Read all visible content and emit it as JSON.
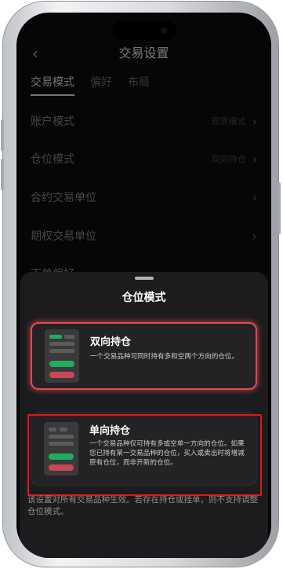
{
  "header": {
    "back_label": "‹",
    "title": "交易设置"
  },
  "tabs": [
    {
      "label": "交易模式",
      "active": true
    },
    {
      "label": "偏好",
      "active": false
    },
    {
      "label": "布局",
      "active": false
    }
  ],
  "settings": [
    {
      "label": "账户模式",
      "value": "现货模式"
    },
    {
      "label": "仓位模式",
      "value": "双向持仓"
    },
    {
      "label": "合约交易单位",
      "value": ""
    },
    {
      "label": "期权交易单位",
      "value": ""
    },
    {
      "label": "下单偏好",
      "value": ""
    }
  ],
  "sheet": {
    "title": "仓位模式",
    "options": [
      {
        "title": "双向持仓",
        "description": "一个交易品种可同时持有多和空两个方向的仓位。",
        "selected": true
      },
      {
        "title": "单向持仓",
        "description": "一个交易品种仅可持有多或空单一方向的仓位。如果您已持有某一交易品种的仓位，买入或卖出时将增减原有仓位，而非开新的仓位。",
        "selected": false
      }
    ],
    "footnote": "该设置对所有交易品种生效。若存在持仓或挂单，则不支持调整仓位模式。"
  },
  "colors": {
    "selected_border": "#e04a52",
    "highlight_box": "#e2161a",
    "long_green": "#1fae5b",
    "short_red": "#c94655"
  }
}
